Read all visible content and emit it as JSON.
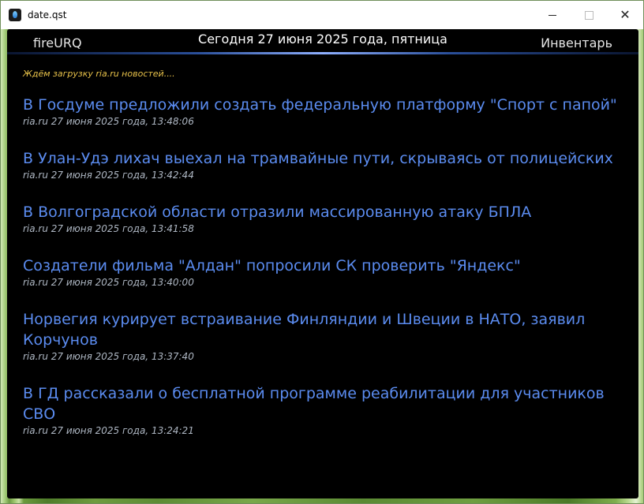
{
  "window": {
    "title": "date.qst"
  },
  "header": {
    "left": "fireURQ",
    "center": "Сегодня 27 июня 2025 года, пятница",
    "right": "Инвентарь"
  },
  "main": {
    "loading": "Ждём загрузку ria.ru новостей....",
    "news": [
      {
        "title": "В Госдуме предложили создать федеральную платформу \"Спорт с папой\"",
        "meta": "ria.ru 27 июня 2025 года, 13:48:06"
      },
      {
        "title": "В Улан-Удэ лихач выехал на трамвайные пути, скрываясь от полицейских",
        "meta": "ria.ru 27 июня 2025 года, 13:42:44"
      },
      {
        "title": "В Волгоградской области отразили массированную атаку БПЛА",
        "meta": "ria.ru 27 июня 2025 года, 13:41:58"
      },
      {
        "title": "Создатели фильма \"Алдан\" попросили СК проверить \"Яндекс\"",
        "meta": "ria.ru 27 июня 2025 года, 13:40:00"
      },
      {
        "title": "Норвегия курирует встраивание Финляндии и Швеции в НАТО, заявил Корчунов",
        "meta": "ria.ru 27 июня 2025 года, 13:37:40"
      },
      {
        "title": "В ГД рассказали о бесплатной программе реабилитации для участников СВО",
        "meta": "ria.ru 27 июня 2025 года, 13:24:21"
      }
    ]
  },
  "colors": {
    "link": "#5b8cf0",
    "loading": "#e8c24a",
    "meta": "#aeb7c3",
    "background": "#000000"
  },
  "icons": {
    "app": "flame-icon",
    "minimize": "minimize-icon",
    "maximize": "maximize-icon",
    "close": "close-icon"
  }
}
